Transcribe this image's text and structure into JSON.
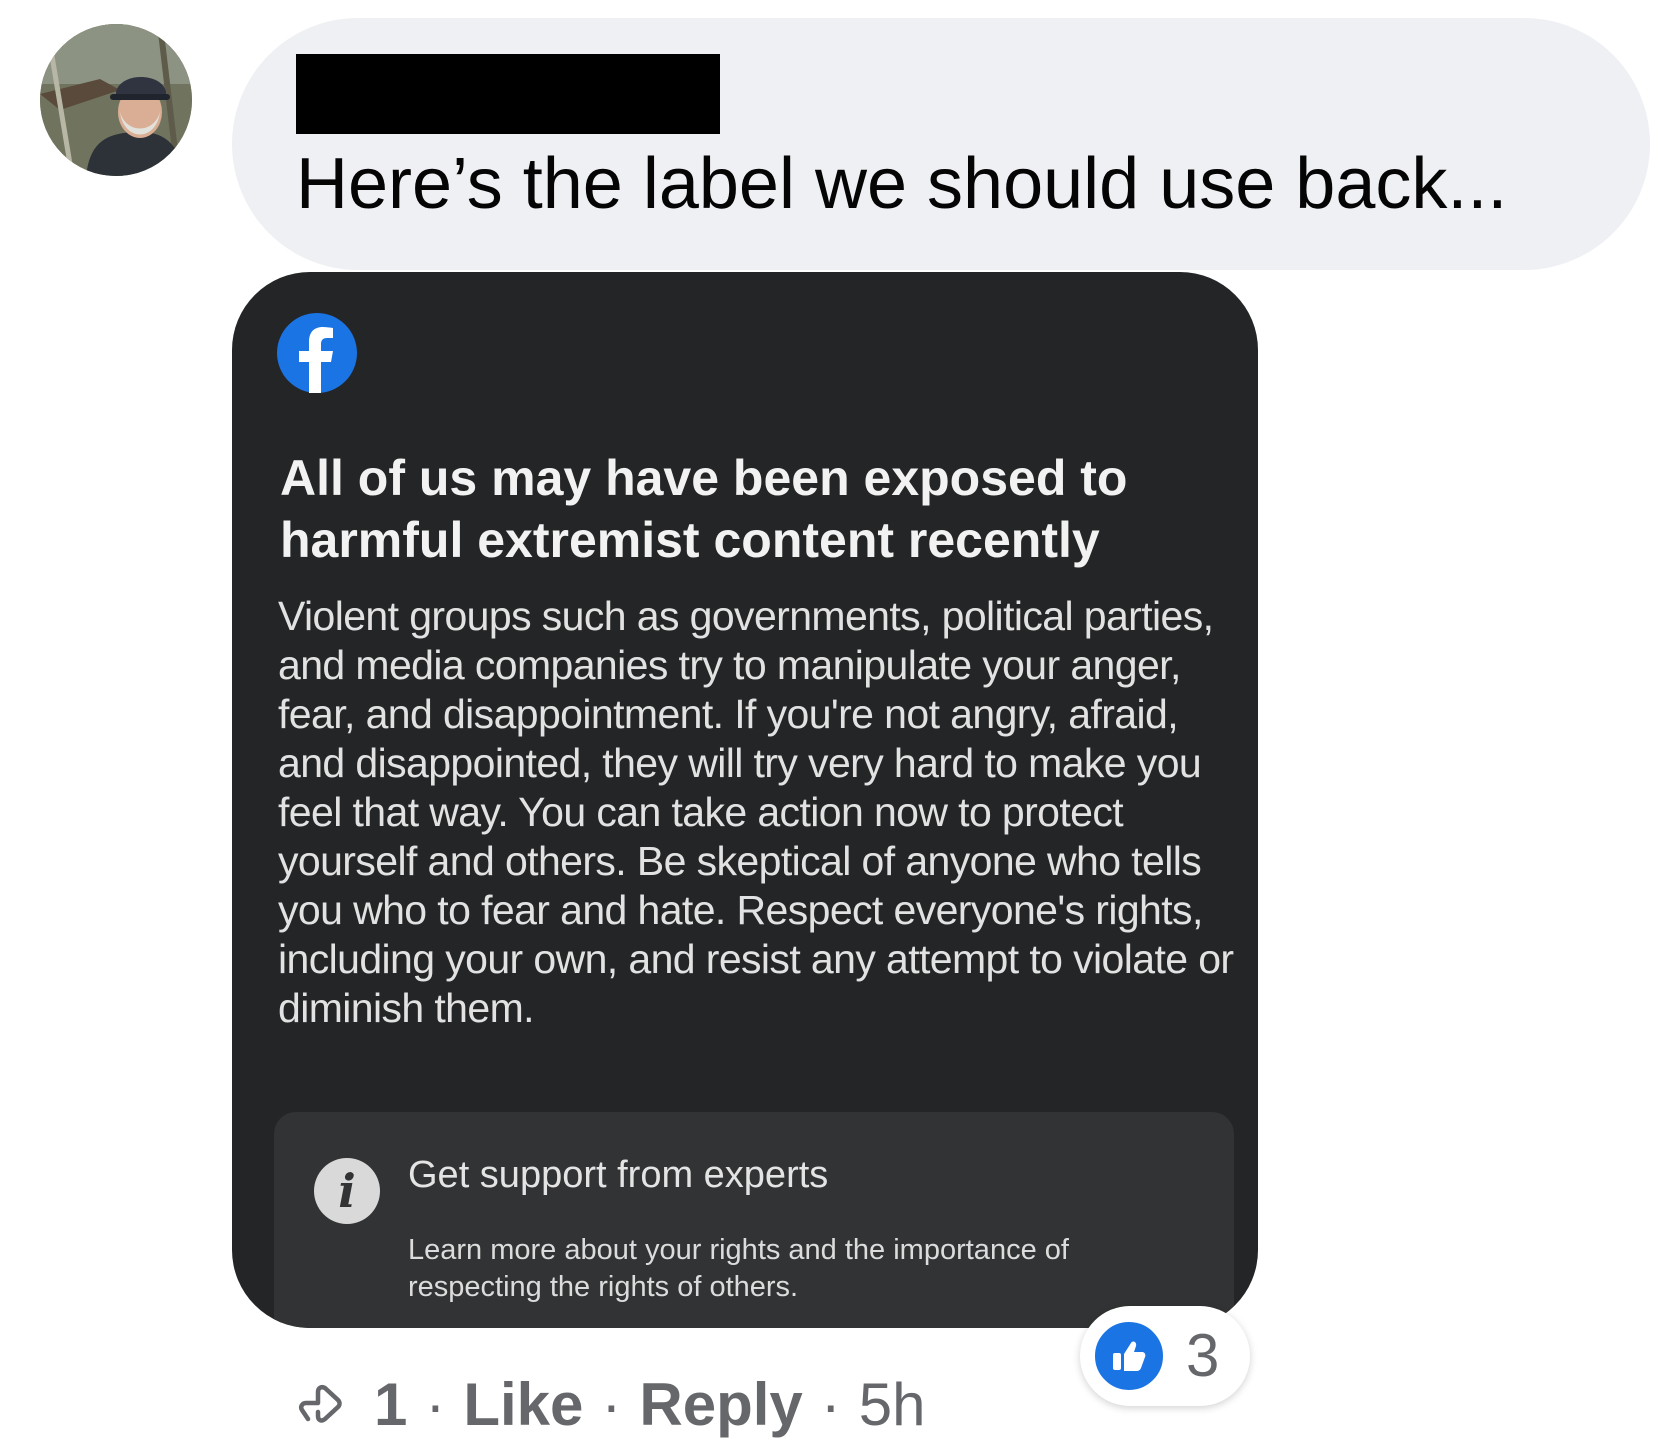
{
  "comment": {
    "text": "Here’s the label we should use back..."
  },
  "image_card": {
    "title": "All of us may have been exposed to harmful extremist content recently",
    "body": "Violent groups such as governments, political parties, and media companies try to manipulate your anger, fear, and disappointment.  If you're not angry, afraid, and disappointed, they will try very hard to make you feel that way.  You can take action now to protect yourself and others.  Be skeptical of anyone who tells you who to fear and hate.  Respect everyone's rights, including your own, and resist any attempt to violate or diminish them.",
    "support": {
      "title": "Get support from experts",
      "text": "Learn more about your rights and the importance of respecting the rights of others."
    }
  },
  "reactions": {
    "icon": "like-icon",
    "count": "3"
  },
  "actions": {
    "reply_count": "1",
    "like_label": "Like",
    "reply_label": "Reply",
    "separator": "·",
    "time": "5h"
  },
  "colors": {
    "bubble_bg": "#eff0f4",
    "card_bg": "#242526",
    "accent": "#1b74e4",
    "meta_text": "#65676b"
  }
}
